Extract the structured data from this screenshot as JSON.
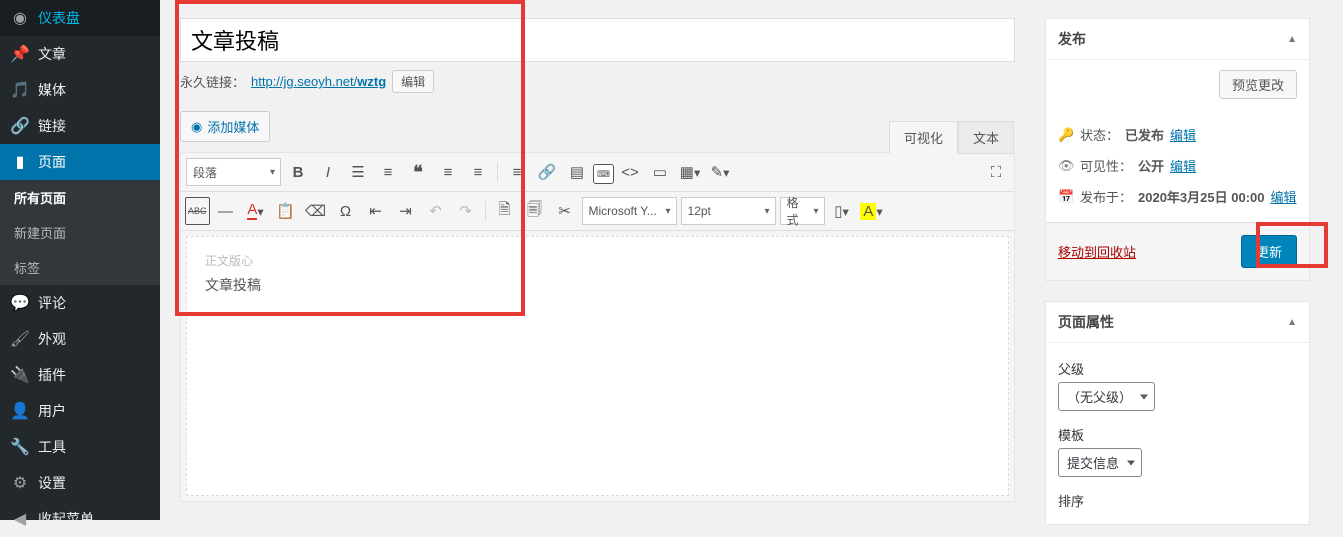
{
  "sidebar": {
    "items": [
      {
        "label": "仪表盘"
      },
      {
        "label": "文章"
      },
      {
        "label": "媒体"
      },
      {
        "label": "链接"
      },
      {
        "label": "页面"
      },
      {
        "label": "评论"
      },
      {
        "label": "外观"
      },
      {
        "label": "插件"
      },
      {
        "label": "用户"
      },
      {
        "label": "工具"
      },
      {
        "label": "设置"
      }
    ],
    "sub_pages": [
      {
        "label": "所有页面"
      },
      {
        "label": "新建页面"
      },
      {
        "label": "标签"
      }
    ],
    "collapse": "收起菜单"
  },
  "editor": {
    "title_value": "文章投稿",
    "permalink_label": "永久链接：",
    "permalink_url_prefix": "http://jg.seoyh.net/",
    "permalink_slug": "wztg",
    "permalink_edit": "编辑",
    "add_media": "添加媒体",
    "tab_visual": "可视化",
    "tab_text": "文本",
    "format_select": "段落",
    "font_select": "Microsoft Y...",
    "size_select": "12pt",
    "style_select": "格式",
    "body_placeholder": "正文版心",
    "body_content": "文章投稿"
  },
  "publish": {
    "panel_title": "发布",
    "preview_btn": "预览更改",
    "status_label": "状态：",
    "status_value": "已发布",
    "visibility_label": "可见性：",
    "visibility_value": "公开",
    "date_label": "发布于：",
    "date_value": "2020年3月25日 00:00",
    "edit_link": "编辑",
    "trash": "移动到回收站",
    "update_btn": "更新"
  },
  "attrs": {
    "panel_title": "页面属性",
    "parent_label": "父级",
    "parent_value": "（无父级）",
    "template_label": "模板",
    "template_value": "提交信息",
    "order_label": "排序"
  }
}
